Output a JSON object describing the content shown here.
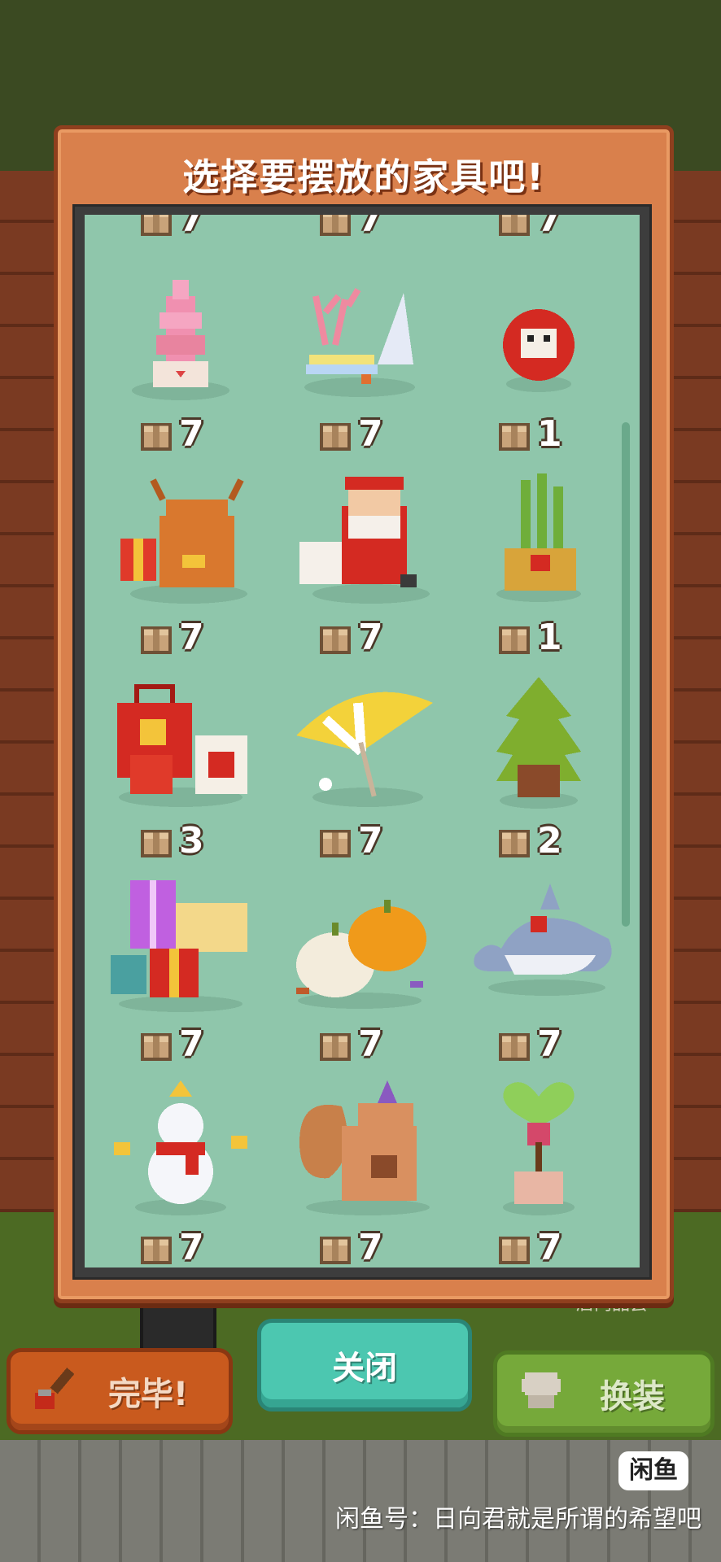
{
  "modal": {
    "title": "选择要摆放的家具吧!"
  },
  "grid": {
    "top_partial_counts": [
      "7",
      "7",
      "7"
    ],
    "items": [
      {
        "name": "pink-cake-stand",
        "count": "7"
      },
      {
        "name": "coral-and-shell",
        "count": "7"
      },
      {
        "name": "daruma-doll",
        "count": "1"
      },
      {
        "name": "reindeer-plush",
        "count": "7"
      },
      {
        "name": "santa-claus",
        "count": "7"
      },
      {
        "name": "kadomatsu",
        "count": "1"
      },
      {
        "name": "lucky-bags",
        "count": "3"
      },
      {
        "name": "beach-parasol",
        "count": "7"
      },
      {
        "name": "potted-tree",
        "count": "2"
      },
      {
        "name": "gift-boxes",
        "count": "7"
      },
      {
        "name": "pumpkins",
        "count": "7"
      },
      {
        "name": "shark-plush",
        "count": "7"
      },
      {
        "name": "snowman",
        "count": "7"
      },
      {
        "name": "squirrel",
        "count": "7"
      },
      {
        "name": "heart-topiary",
        "count": "7"
      }
    ]
  },
  "buttons": {
    "done_label": "完毕!",
    "close_label": "关闭",
    "change_label": "换装"
  },
  "background": {
    "shop_label": "店内品尝"
  },
  "watermark": {
    "logo": "闲鱼",
    "text": "闲鱼号：日向君就是所谓的希望吧"
  },
  "colors": {
    "panel": "#d9804c",
    "grid_bg": "#8fc6ab",
    "close_button": "#4cc7b0",
    "done_button": "#c95a1e",
    "change_button": "#76a93a"
  }
}
